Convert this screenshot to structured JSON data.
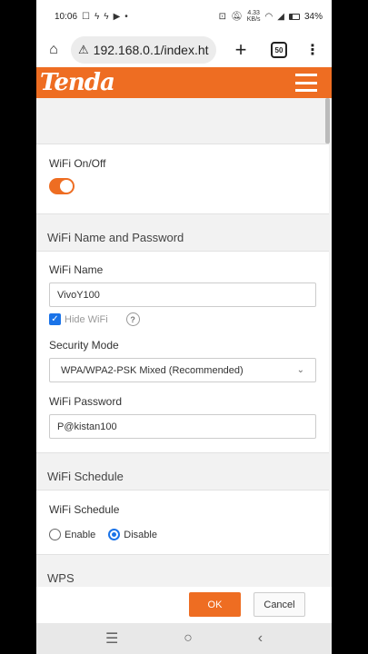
{
  "status_bar": {
    "time": "10:06",
    "network_speed_value": "4.33",
    "network_speed_unit": "KB/s",
    "battery": "34%"
  },
  "browser": {
    "url": "192.168.0.1/index.ht",
    "tab_count": "50"
  },
  "header": {
    "logo_text": "Tenda"
  },
  "wifi_switch": {
    "label": "WiFi On/Off",
    "enabled": true
  },
  "wifi_name_password": {
    "section_title": "WiFi Name and Password",
    "name_label": "WiFi Name",
    "name_value": "VivoY100",
    "hide_wifi_label": "Hide WiFi",
    "hide_wifi_checked": true,
    "help_glyph": "?",
    "security_label": "Security Mode",
    "security_value": "WPA/WPA2-PSK Mixed (Recommended)",
    "password_label": "WiFi Password",
    "password_value": "P@kistan100"
  },
  "wifi_schedule": {
    "section_title": "WiFi Schedule",
    "label": "WiFi Schedule",
    "option_enable": "Enable",
    "option_disable": "Disable",
    "selected": "Disable"
  },
  "wps": {
    "section_title": "WPS"
  },
  "footer": {
    "ok_label": "OK",
    "cancel_label": "Cancel"
  },
  "icons": {
    "home": "home-icon",
    "warning": "warning-icon",
    "add_tab": "plus-icon",
    "tabs": "tabs-icon",
    "more": "more-vert-icon",
    "menu": "hamburger-icon",
    "chevron": "chevron-down-icon",
    "nav_recent": "recent-apps-icon",
    "nav_home": "nav-home-icon",
    "nav_back": "back-icon"
  },
  "colors": {
    "brand_orange": "#ee6d22",
    "checkbox_blue": "#1a73e8"
  }
}
